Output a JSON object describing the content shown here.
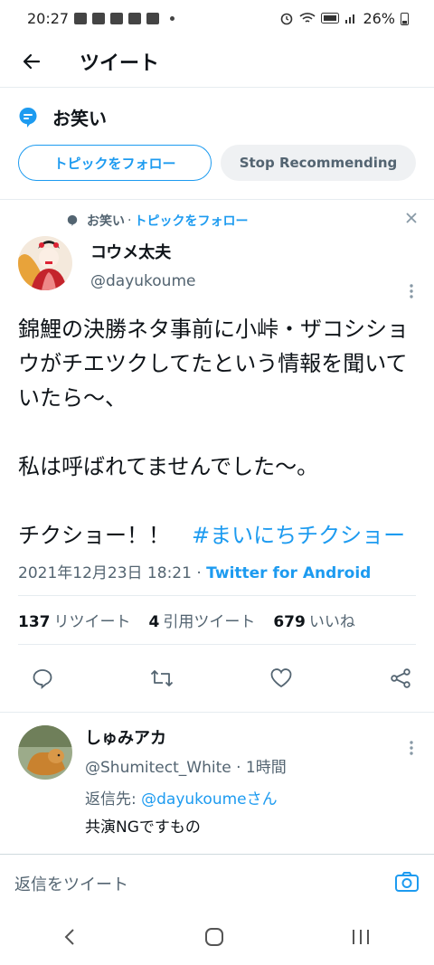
{
  "statusbar": {
    "time": "20:27",
    "battery": "26%"
  },
  "header": {
    "title": "ツイート"
  },
  "topic": {
    "name": "お笑い",
    "follow_label": "トピックをフォロー",
    "stop_label": "Stop Recommending"
  },
  "tweet": {
    "context_topic": "お笑い",
    "context_sep": "·",
    "context_follow": "トピックをフォロー",
    "author_name": "コウメ太夫",
    "author_handle": "@dayukoume",
    "text": "錦鯉の決勝ネタ事前に小峠・ザコシショウがチエツクしてたという情報を聞いていたら〜、\n\n私は呼ばれてませんでした〜。\n\nチクショー！！　",
    "hashtag": "#まいにちチクショー",
    "timestamp": "2021年12月23日 18:21 · ",
    "source": "Twitter for Android",
    "retweets_count": "137",
    "retweets_label": "リツイート",
    "quotes_count": "4",
    "quotes_label": "引用ツイート",
    "likes_count": "679",
    "likes_label": "いいね"
  },
  "reply": {
    "name": "しゅみアカ",
    "handle": "@Shumitect_White · 1時間",
    "reply_to_prefix": "返信先: ",
    "reply_to_mention": "@dayukoumeさん",
    "text": "共演NGですもの"
  },
  "compose": {
    "placeholder": "返信をツイート"
  },
  "colors": {
    "accent": "#1d9bf0",
    "text": "#0f1419",
    "secondary": "#536471"
  }
}
